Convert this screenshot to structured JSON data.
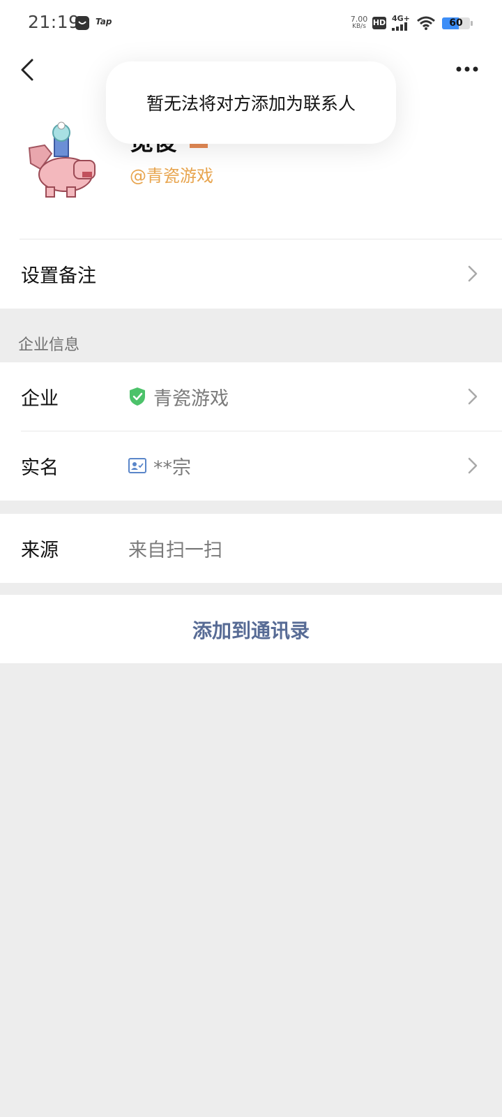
{
  "status_bar": {
    "time": "21:19",
    "app_icons": [
      "chat-bubble-icon",
      "tap-icon"
    ],
    "tap_label": "Tap",
    "net_speed_value": "7.00",
    "net_speed_unit": "KB/s",
    "hd_label": "HD",
    "network_label": "4G+",
    "battery_level": "60",
    "battery_fraction": 0.6
  },
  "toast": {
    "message": "暂无法将对方添加为联系人"
  },
  "profile": {
    "name": "觅俊",
    "corp_handle": "@青瓷游戏"
  },
  "rows": {
    "remark_label": "设置备注",
    "enterprise_section_label": "企业信息",
    "enterprise_label": "企业",
    "enterprise_value": "青瓷游戏",
    "realname_label": "实名",
    "realname_value": "**宗",
    "source_label": "来源",
    "source_value": "来自扫一扫"
  },
  "actions": {
    "add_to_contacts": "添加到通讯录"
  },
  "colors": {
    "accent_link": "#576b95",
    "corp_orange": "#e8a54f",
    "verified_green": "#4cc26a",
    "battery_blue": "#3d8ef7"
  }
}
